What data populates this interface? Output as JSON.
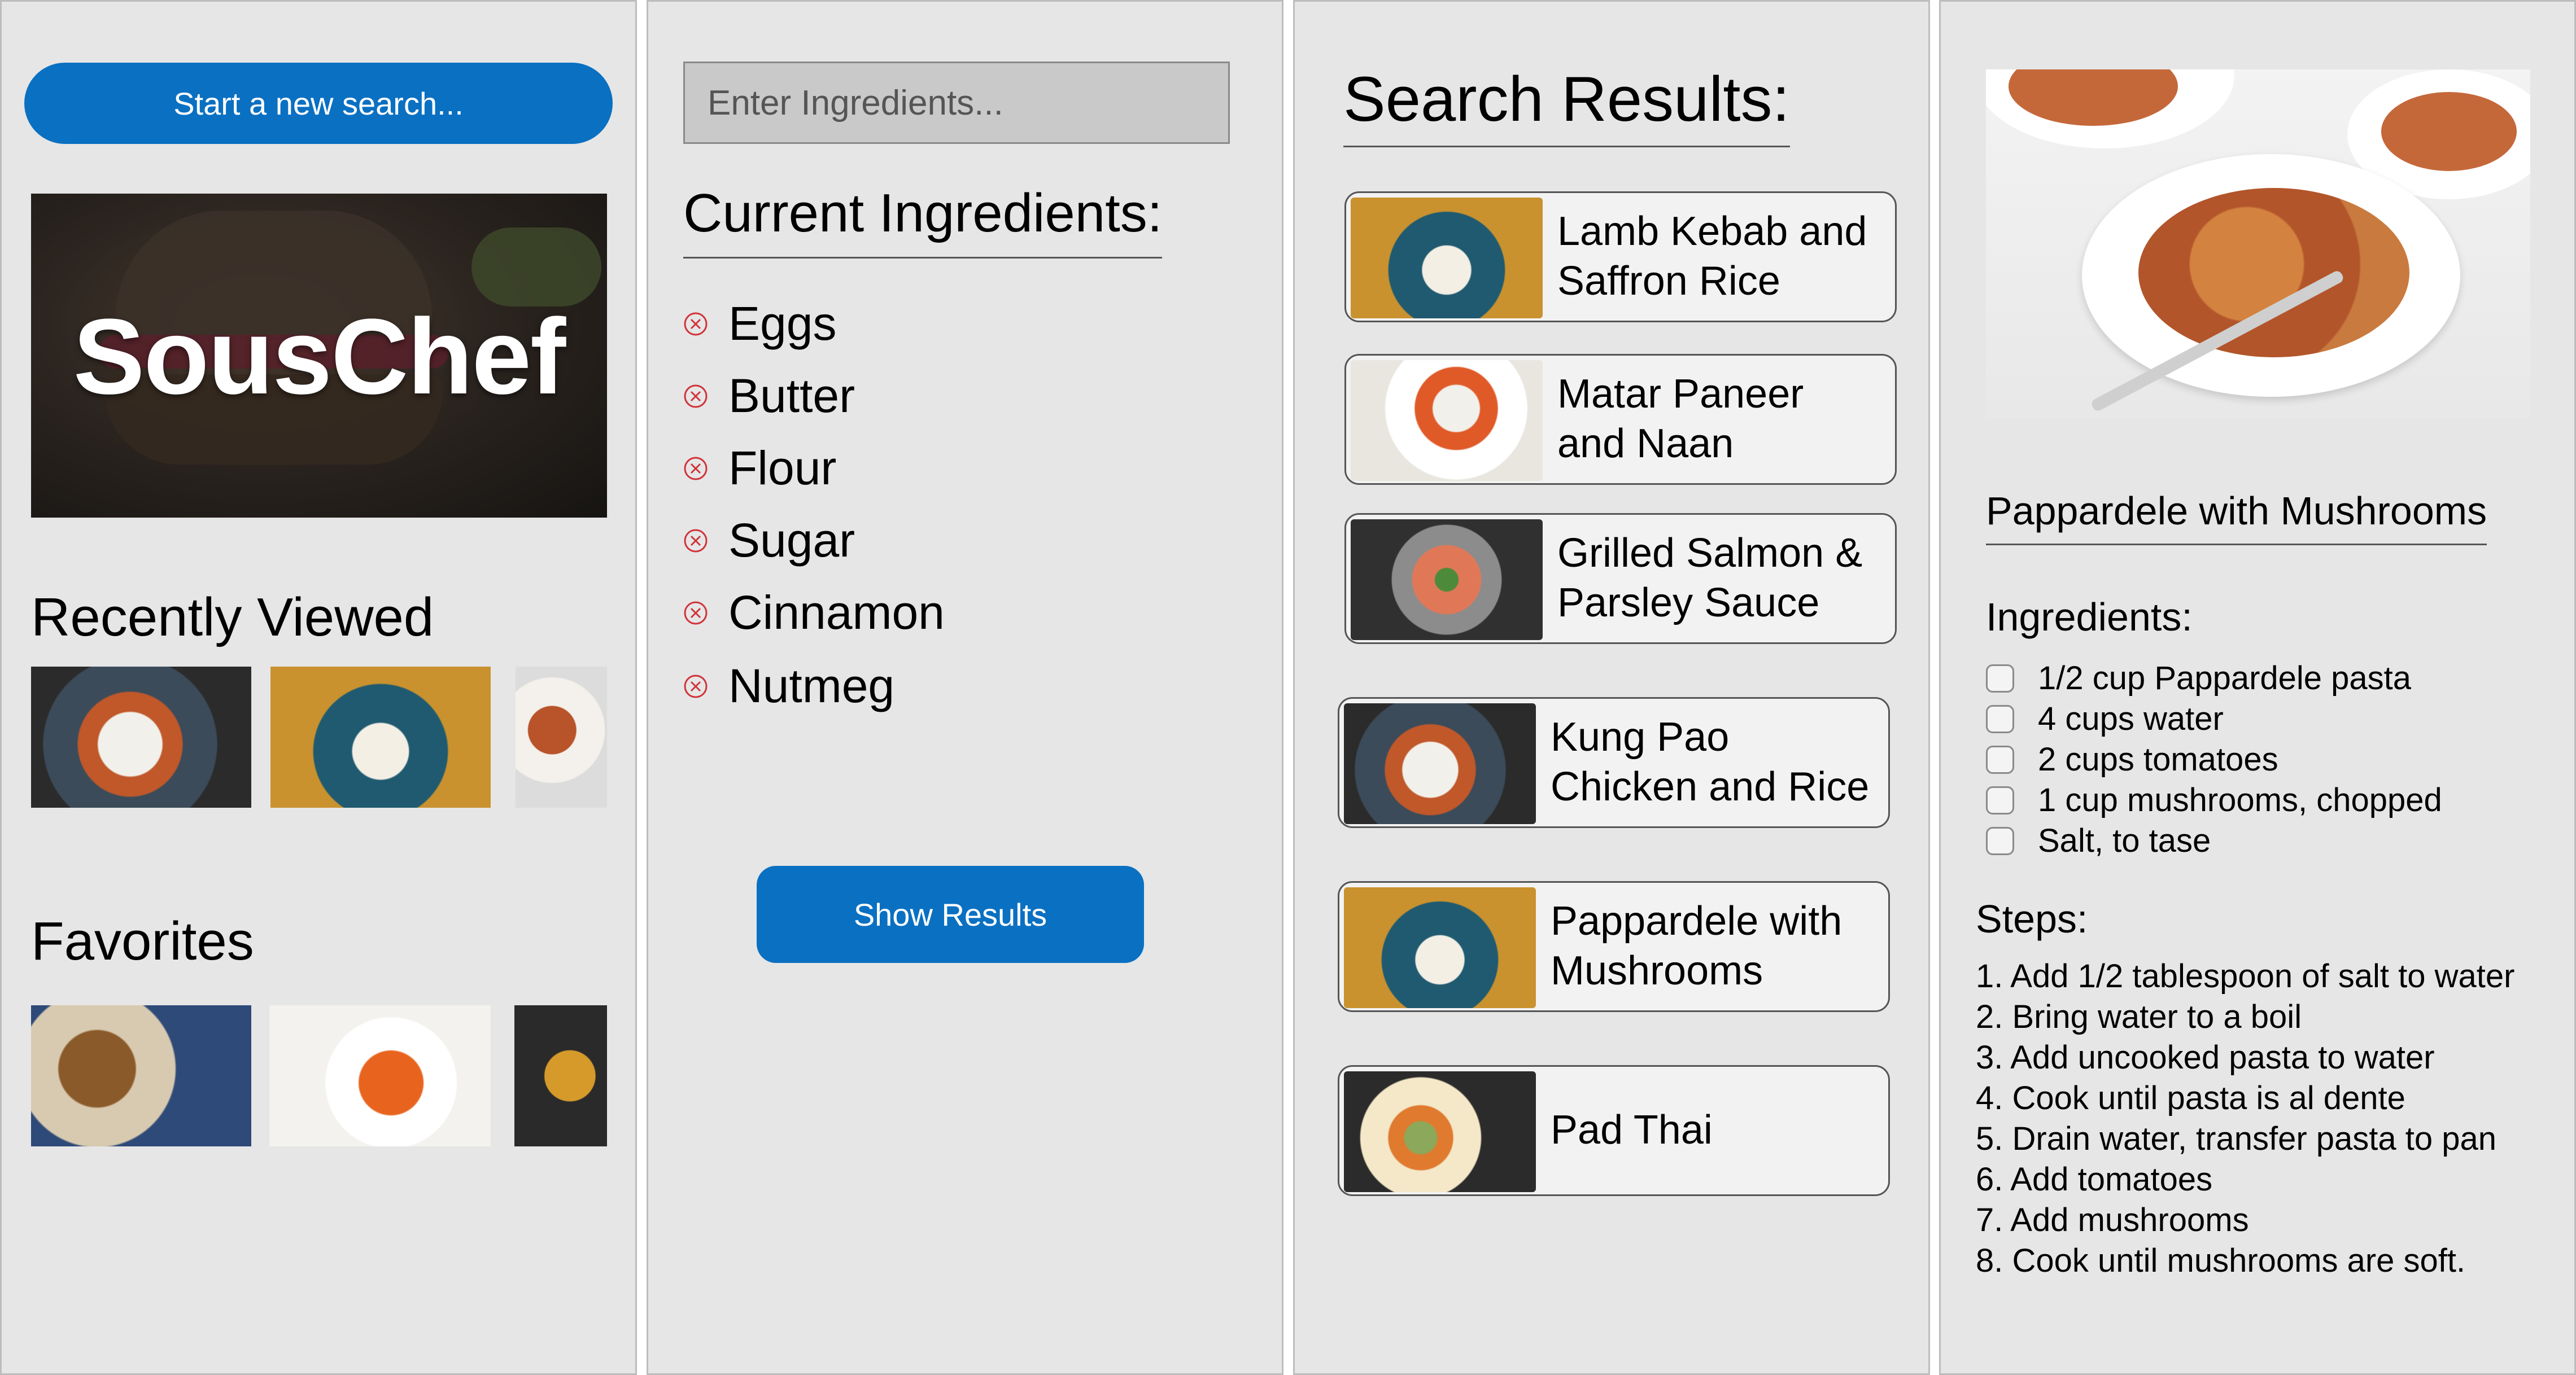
{
  "home": {
    "search_button": "Start a new search...",
    "app_name": "SousChef",
    "recently_viewed_title": "Recently Viewed",
    "favorites_title": "Favorites"
  },
  "ingredients_screen": {
    "input_placeholder": "Enter Ingredients...",
    "current_title": "Current Ingredients:",
    "items": [
      "Eggs",
      "Butter",
      "Flour",
      "Sugar",
      "Cinnamon",
      "Nutmeg"
    ],
    "show_results_button": "Show Results"
  },
  "results_screen": {
    "title": "Search Results:",
    "results": [
      "Lamb Kebab and Saffron Rice",
      "Matar Paneer and Naan",
      "Grilled Salmon & Parsley Sauce",
      "Kung Pao Chicken and Rice",
      "Pappardele with Mushrooms",
      "Pad Thai"
    ]
  },
  "recipe_screen": {
    "title": "Pappardele with Mushrooms",
    "ingredients_label": "Ingredients:",
    "ingredients": [
      "1/2 cup Pappardele pasta",
      "4 cups water",
      "2 cups tomatoes",
      "1 cup mushrooms, chopped",
      "Salt, to tase"
    ],
    "steps_label": "Steps:",
    "steps": [
      "1. Add 1/2 tablespoon of salt to water",
      "2. Bring water to a boil",
      "3. Add uncooked pasta to water",
      "4. Cook until pasta is al dente",
      "5. Drain water, transfer pasta to pan",
      "6. Add tomatoes",
      "7. Add mushrooms",
      "8. Cook until mushrooms are soft."
    ]
  },
  "colors": {
    "accent_blue": "#0a70c2",
    "remove_red": "#d0343a",
    "panel_bg": "#e6e6e6"
  }
}
